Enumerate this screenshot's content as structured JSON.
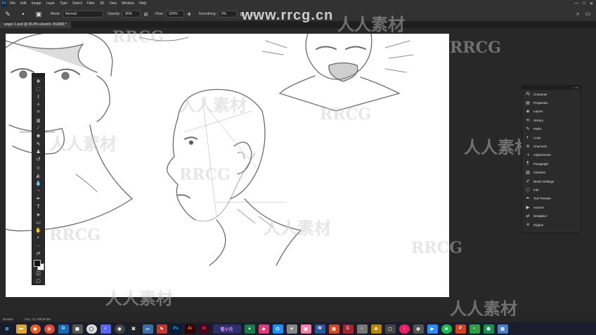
{
  "menu": {
    "logo": "Ps",
    "items": [
      "File",
      "Edit",
      "Image",
      "Layer",
      "Type",
      "Select",
      "Filter",
      "3D",
      "View",
      "Window",
      "Help"
    ]
  },
  "window_controls": [
    "—",
    "□",
    "✕"
  ],
  "options": {
    "mode_label": "Mode:",
    "mode_value": "Normal",
    "opacity_label": "Opacity:",
    "opacity_value": "89%",
    "flow_label": "Flow:",
    "flow_value": "100%",
    "smoothing_label": "Smoothing:",
    "smoothing_value": "0%"
  },
  "document_tab": "anger-1.psd @ 65.8% (sketch, RGB/8) *",
  "status": {
    "zoom": "65.85%",
    "doc": "Doc: 14.7M/29.6M"
  },
  "watermark": {
    "site": "www.rrcg.cn",
    "latin": "RRCG",
    "cjk": "人人素材"
  },
  "panel": {
    "items": [
      {
        "label": "Character",
        "icon": "A|"
      },
      {
        "label": "Properties",
        "icon": "▤"
      },
      {
        "label": "Layers",
        "icon": "◈"
      },
      {
        "label": "History",
        "icon": "⟲"
      },
      {
        "label": "Paths",
        "icon": "✎"
      },
      {
        "label": "Color",
        "icon": "◐"
      },
      {
        "label": "Channels",
        "icon": "≋"
      },
      {
        "label": "Adjustments",
        "icon": "◑"
      },
      {
        "label": "Paragraph",
        "icon": "¶"
      },
      {
        "label": "Libraries",
        "icon": "▥"
      },
      {
        "label": "Brush Settings",
        "icon": "✐"
      },
      {
        "label": "Info",
        "icon": "ⓘ"
      },
      {
        "label": "Tool Presets",
        "icon": "✒"
      },
      {
        "label": "Actions",
        "icon": "▶"
      },
      {
        "label": "Navigator",
        "icon": "⇄"
      },
      {
        "label": "Glyphs",
        "icon": "a"
      }
    ]
  },
  "taskbar_overlay": "看小月"
}
